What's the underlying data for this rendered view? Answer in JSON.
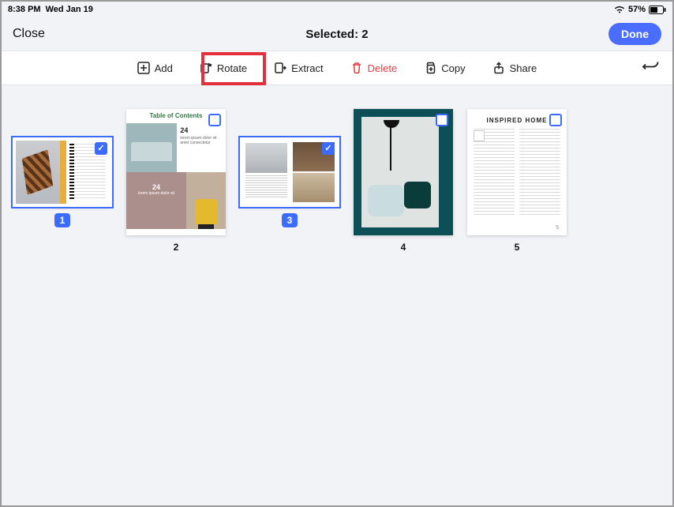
{
  "status": {
    "time": "8:38 PM",
    "date": "Wed Jan 19",
    "battery": "57%"
  },
  "nav": {
    "close": "Close",
    "title": "Selected: 2",
    "done": "Done"
  },
  "toolbar": {
    "add": "Add",
    "rotate": "Rotate",
    "extract": "Extract",
    "delete": "Delete",
    "copy": "Copy",
    "share": "Share"
  },
  "pages": {
    "p1": {
      "num": "1"
    },
    "p2": {
      "num": "2",
      "toc": "Table of Contents",
      "n24": "24"
    },
    "p3": {
      "num": "3"
    },
    "p4": {
      "num": "4"
    },
    "p5": {
      "num": "5",
      "title": "INSPIRED HOME",
      "foot": "5"
    }
  }
}
